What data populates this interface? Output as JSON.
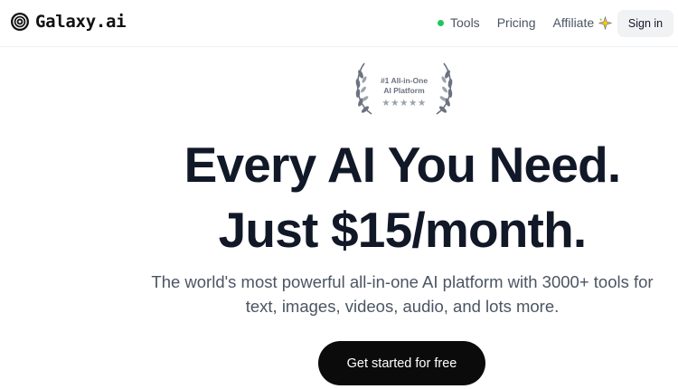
{
  "brand": {
    "name": "Galaxy.ai",
    "icon": "galaxy-ring-icon"
  },
  "nav": {
    "tools": "Tools",
    "pricing": "Pricing",
    "affiliate": "Affiliate",
    "tools_status_color": "#22c55e",
    "affiliate_icon": "sparkle-icon"
  },
  "signin_label": "Sign in",
  "badge": {
    "line1": "#1 All-in-One",
    "line2": "AI Platform",
    "stars": "★★★★★",
    "rating": 5
  },
  "hero": {
    "headline_line1": "Every AI You Need.",
    "headline_line2": "Just $15/month.",
    "sub_line1": "The world's most powerful all-in-one AI platform with 3000+ tools for",
    "sub_line2": "text, images, videos, audio, and lots more."
  },
  "cta_label": "Get started for free",
  "colors": {
    "cta_bg": "#0b0b0c",
    "text_dark": "#111827",
    "text_muted": "#4b5563"
  }
}
